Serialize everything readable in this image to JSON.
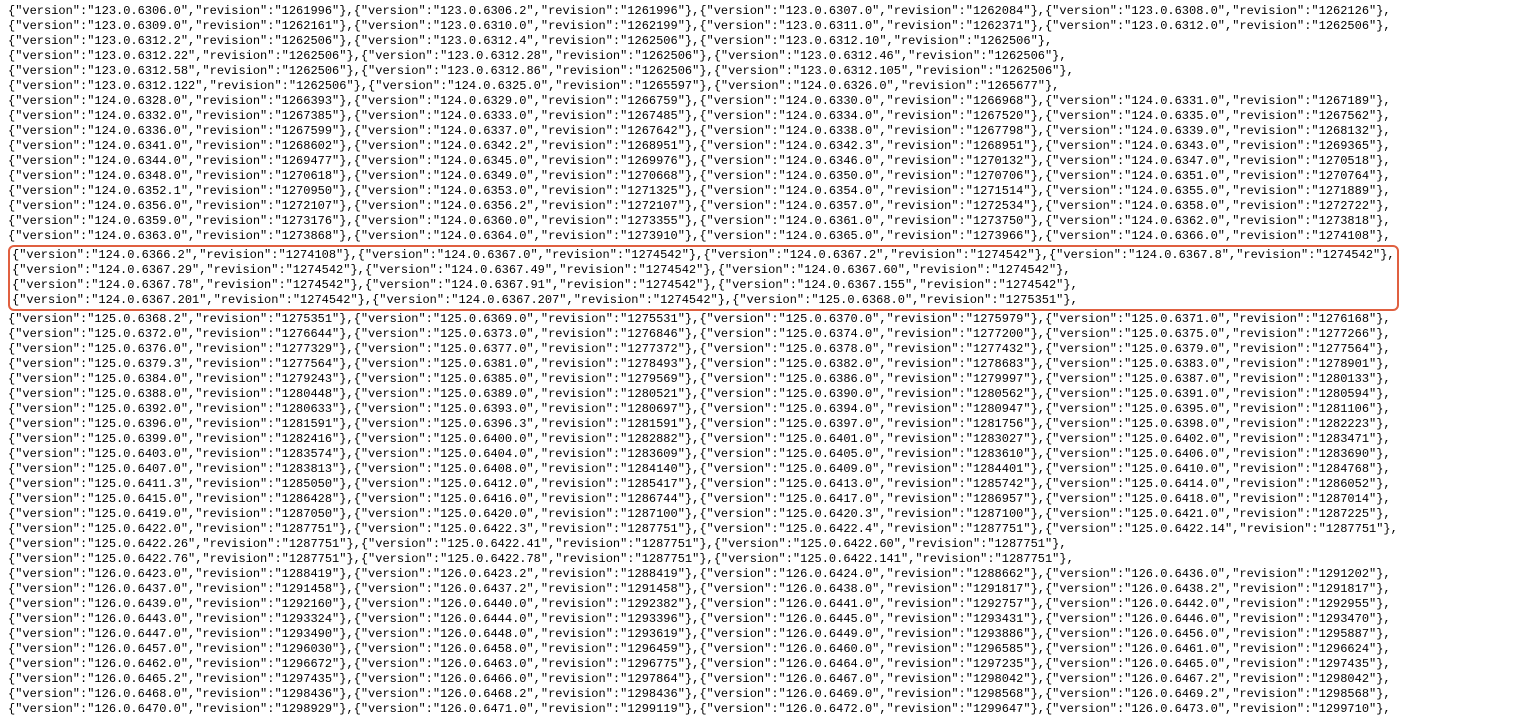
{
  "pre_lines": [
    [
      [
        "123.0.6306.0",
        "1261996"
      ],
      [
        "123.0.6306.2",
        "1261996"
      ],
      [
        "123.0.6307.0",
        "1262084"
      ],
      [
        "123.0.6308.0",
        "1262126"
      ]
    ],
    [
      [
        "123.0.6309.0",
        "1262161"
      ],
      [
        "123.0.6310.0",
        "1262199"
      ],
      [
        "123.0.6311.0",
        "1262371"
      ],
      [
        "123.0.6312.0",
        "1262506"
      ]
    ],
    [
      [
        "123.0.6312.2",
        "1262506"
      ],
      [
        "123.0.6312.4",
        "1262506"
      ],
      [
        "123.0.6312.10",
        "1262506"
      ]
    ],
    [
      [
        "123.0.6312.22",
        "1262506"
      ],
      [
        "123.0.6312.28",
        "1262506"
      ],
      [
        "123.0.6312.46",
        "1262506"
      ]
    ],
    [
      [
        "123.0.6312.58",
        "1262506"
      ],
      [
        "123.0.6312.86",
        "1262506"
      ],
      [
        "123.0.6312.105",
        "1262506"
      ]
    ],
    [
      [
        "123.0.6312.122",
        "1262506"
      ],
      [
        "124.0.6325.0",
        "1265597"
      ],
      [
        "124.0.6326.0",
        "1265677"
      ]
    ],
    [
      [
        "124.0.6328.0",
        "1266393"
      ],
      [
        "124.0.6329.0",
        "1266759"
      ],
      [
        "124.0.6330.0",
        "1266968"
      ],
      [
        "124.0.6331.0",
        "1267189"
      ]
    ],
    [
      [
        "124.0.6332.0",
        "1267385"
      ],
      [
        "124.0.6333.0",
        "1267485"
      ],
      [
        "124.0.6334.0",
        "1267520"
      ],
      [
        "124.0.6335.0",
        "1267562"
      ]
    ],
    [
      [
        "124.0.6336.0",
        "1267599"
      ],
      [
        "124.0.6337.0",
        "1267642"
      ],
      [
        "124.0.6338.0",
        "1267798"
      ],
      [
        "124.0.6339.0",
        "1268132"
      ]
    ],
    [
      [
        "124.0.6341.0",
        "1268602"
      ],
      [
        "124.0.6342.2",
        "1268951"
      ],
      [
        "124.0.6342.3",
        "1268951"
      ],
      [
        "124.0.6343.0",
        "1269365"
      ]
    ],
    [
      [
        "124.0.6344.0",
        "1269477"
      ],
      [
        "124.0.6345.0",
        "1269976"
      ],
      [
        "124.0.6346.0",
        "1270132"
      ],
      [
        "124.0.6347.0",
        "1270518"
      ]
    ],
    [
      [
        "124.0.6348.0",
        "1270618"
      ],
      [
        "124.0.6349.0",
        "1270668"
      ],
      [
        "124.0.6350.0",
        "1270706"
      ],
      [
        "124.0.6351.0",
        "1270764"
      ]
    ],
    [
      [
        "124.0.6352.1",
        "1270950"
      ],
      [
        "124.0.6353.0",
        "1271325"
      ],
      [
        "124.0.6354.0",
        "1271514"
      ],
      [
        "124.0.6355.0",
        "1271889"
      ]
    ],
    [
      [
        "124.0.6356.0",
        "1272107"
      ],
      [
        "124.0.6356.2",
        "1272107"
      ],
      [
        "124.0.6357.0",
        "1272534"
      ],
      [
        "124.0.6358.0",
        "1272722"
      ]
    ],
    [
      [
        "124.0.6359.0",
        "1273176"
      ],
      [
        "124.0.6360.0",
        "1273355"
      ],
      [
        "124.0.6361.0",
        "1273750"
      ],
      [
        "124.0.6362.0",
        "1273818"
      ]
    ],
    [
      [
        "124.0.6363.0",
        "1273868"
      ],
      [
        "124.0.6364.0",
        "1273910"
      ],
      [
        "124.0.6365.0",
        "1273966"
      ],
      [
        "124.0.6366.0",
        "1274108"
      ]
    ]
  ],
  "hl_lines": [
    [
      [
        "124.0.6366.2",
        "1274108"
      ],
      [
        "124.0.6367.0",
        "1274542"
      ],
      [
        "124.0.6367.2",
        "1274542"
      ],
      [
        "124.0.6367.8",
        "1274542"
      ]
    ],
    [
      [
        "124.0.6367.29",
        "1274542"
      ],
      [
        "124.0.6367.49",
        "1274542"
      ],
      [
        "124.0.6367.60",
        "1274542"
      ]
    ],
    [
      [
        "124.0.6367.78",
        "1274542"
      ],
      [
        "124.0.6367.91",
        "1274542"
      ],
      [
        "124.0.6367.155",
        "1274542"
      ]
    ],
    [
      [
        "124.0.6367.201",
        "1274542"
      ],
      [
        "124.0.6367.207",
        "1274542"
      ],
      [
        "125.0.6368.0",
        "1275351"
      ]
    ]
  ],
  "post_lines": [
    [
      [
        "125.0.6368.2",
        "1275351"
      ],
      [
        "125.0.6369.0",
        "1275531"
      ],
      [
        "125.0.6370.0",
        "1275979"
      ],
      [
        "125.0.6371.0",
        "1276168"
      ]
    ],
    [
      [
        "125.0.6372.0",
        "1276644"
      ],
      [
        "125.0.6373.0",
        "1276846"
      ],
      [
        "125.0.6374.0",
        "1277200"
      ],
      [
        "125.0.6375.0",
        "1277266"
      ]
    ],
    [
      [
        "125.0.6376.0",
        "1277329"
      ],
      [
        "125.0.6377.0",
        "1277372"
      ],
      [
        "125.0.6378.0",
        "1277432"
      ],
      [
        "125.0.6379.0",
        "1277564"
      ]
    ],
    [
      [
        "125.0.6379.3",
        "1277564"
      ],
      [
        "125.0.6381.0",
        "1278493"
      ],
      [
        "125.0.6382.0",
        "1278683"
      ],
      [
        "125.0.6383.0",
        "1278901"
      ]
    ],
    [
      [
        "125.0.6384.0",
        "1279243"
      ],
      [
        "125.0.6385.0",
        "1279569"
      ],
      [
        "125.0.6386.0",
        "1279997"
      ],
      [
        "125.0.6387.0",
        "1280133"
      ]
    ],
    [
      [
        "125.0.6388.0",
        "1280448"
      ],
      [
        "125.0.6389.0",
        "1280521"
      ],
      [
        "125.0.6390.0",
        "1280562"
      ],
      [
        "125.0.6391.0",
        "1280594"
      ]
    ],
    [
      [
        "125.0.6392.0",
        "1280633"
      ],
      [
        "125.0.6393.0",
        "1280697"
      ],
      [
        "125.0.6394.0",
        "1280947"
      ],
      [
        "125.0.6395.0",
        "1281106"
      ]
    ],
    [
      [
        "125.0.6396.0",
        "1281591"
      ],
      [
        "125.0.6396.3",
        "1281591"
      ],
      [
        "125.0.6397.0",
        "1281756"
      ],
      [
        "125.0.6398.0",
        "1282223"
      ]
    ],
    [
      [
        "125.0.6399.0",
        "1282416"
      ],
      [
        "125.0.6400.0",
        "1282882"
      ],
      [
        "125.0.6401.0",
        "1283027"
      ],
      [
        "125.0.6402.0",
        "1283471"
      ]
    ],
    [
      [
        "125.0.6403.0",
        "1283574"
      ],
      [
        "125.0.6404.0",
        "1283609"
      ],
      [
        "125.0.6405.0",
        "1283610"
      ],
      [
        "125.0.6406.0",
        "1283690"
      ]
    ],
    [
      [
        "125.0.6407.0",
        "1283813"
      ],
      [
        "125.0.6408.0",
        "1284140"
      ],
      [
        "125.0.6409.0",
        "1284401"
      ],
      [
        "125.0.6410.0",
        "1284768"
      ]
    ],
    [
      [
        "125.0.6411.3",
        "1285050"
      ],
      [
        "125.0.6412.0",
        "1285417"
      ],
      [
        "125.0.6413.0",
        "1285742"
      ],
      [
        "125.0.6414.0",
        "1286052"
      ]
    ],
    [
      [
        "125.0.6415.0",
        "1286428"
      ],
      [
        "125.0.6416.0",
        "1286744"
      ],
      [
        "125.0.6417.0",
        "1286957"
      ],
      [
        "125.0.6418.0",
        "1287014"
      ]
    ],
    [
      [
        "125.0.6419.0",
        "1287050"
      ],
      [
        "125.0.6420.0",
        "1287100"
      ],
      [
        "125.0.6420.3",
        "1287100"
      ],
      [
        "125.0.6421.0",
        "1287225"
      ]
    ],
    [
      [
        "125.0.6422.0",
        "1287751"
      ],
      [
        "125.0.6422.3",
        "1287751"
      ],
      [
        "125.0.6422.4",
        "1287751"
      ],
      [
        "125.0.6422.14",
        "1287751"
      ]
    ],
    [
      [
        "125.0.6422.26",
        "1287751"
      ],
      [
        "125.0.6422.41",
        "1287751"
      ],
      [
        "125.0.6422.60",
        "1287751"
      ]
    ],
    [
      [
        "125.0.6422.76",
        "1287751"
      ],
      [
        "125.0.6422.78",
        "1287751"
      ],
      [
        "125.0.6422.141",
        "1287751"
      ]
    ],
    [
      [
        "126.0.6423.0",
        "1288419"
      ],
      [
        "126.0.6423.2",
        "1288419"
      ],
      [
        "126.0.6424.0",
        "1288662"
      ],
      [
        "126.0.6436.0",
        "1291202"
      ]
    ],
    [
      [
        "126.0.6437.0",
        "1291458"
      ],
      [
        "126.0.6437.2",
        "1291458"
      ],
      [
        "126.0.6438.0",
        "1291817"
      ],
      [
        "126.0.6438.2",
        "1291817"
      ]
    ],
    [
      [
        "126.0.6439.0",
        "1292160"
      ],
      [
        "126.0.6440.0",
        "1292382"
      ],
      [
        "126.0.6441.0",
        "1292757"
      ],
      [
        "126.0.6442.0",
        "1292955"
      ]
    ],
    [
      [
        "126.0.6443.0",
        "1293324"
      ],
      [
        "126.0.6444.0",
        "1293396"
      ],
      [
        "126.0.6445.0",
        "1293431"
      ],
      [
        "126.0.6446.0",
        "1293470"
      ]
    ],
    [
      [
        "126.0.6447.0",
        "1293490"
      ],
      [
        "126.0.6448.0",
        "1293619"
      ],
      [
        "126.0.6449.0",
        "1293886"
      ],
      [
        "126.0.6456.0",
        "1295887"
      ]
    ],
    [
      [
        "126.0.6457.0",
        "1296030"
      ],
      [
        "126.0.6458.0",
        "1296459"
      ],
      [
        "126.0.6460.0",
        "1296585"
      ],
      [
        "126.0.6461.0",
        "1296624"
      ]
    ],
    [
      [
        "126.0.6462.0",
        "1296672"
      ],
      [
        "126.0.6463.0",
        "1296775"
      ],
      [
        "126.0.6464.0",
        "1297235"
      ],
      [
        "126.0.6465.0",
        "1297435"
      ]
    ],
    [
      [
        "126.0.6465.2",
        "1297435"
      ],
      [
        "126.0.6466.0",
        "1297864"
      ],
      [
        "126.0.6467.0",
        "1298042"
      ],
      [
        "126.0.6467.2",
        "1298042"
      ]
    ],
    [
      [
        "126.0.6468.0",
        "1298436"
      ],
      [
        "126.0.6468.2",
        "1298436"
      ],
      [
        "126.0.6469.0",
        "1298568"
      ],
      [
        "126.0.6469.2",
        "1298568"
      ]
    ],
    [
      [
        "126.0.6470.0",
        "1298929"
      ],
      [
        "126.0.6471.0",
        "1299119"
      ],
      [
        "126.0.6472.0",
        "1299647"
      ],
      [
        "126.0.6473.0",
        "1299710"
      ]
    ]
  ]
}
